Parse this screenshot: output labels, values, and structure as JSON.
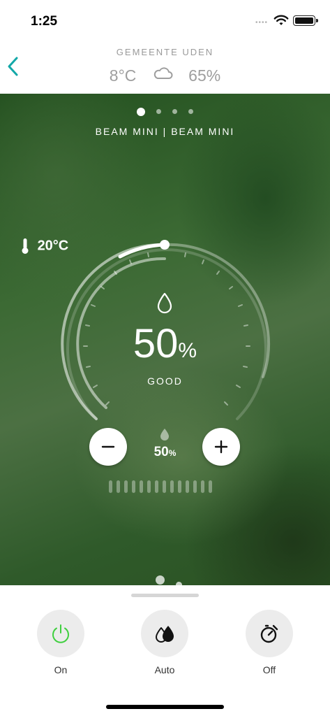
{
  "status_bar": {
    "time": "1:25",
    "signal_dots": "••••"
  },
  "header": {
    "location": "GEMEENTE UDEN",
    "outdoor_temp": "8°C",
    "weather_icon": "cloud-icon",
    "outdoor_humidity": "65%"
  },
  "carousel": {
    "pages": 4,
    "active_page": 1
  },
  "device": {
    "name": "BEAM MINI | BEAM MINI",
    "room_temperature": "20°C",
    "humidity_value": "50",
    "humidity_unit": "%",
    "humidity_status": "GOOD",
    "target_value": "50",
    "target_unit": "%",
    "dial_level_fraction": 0.5,
    "fan_levels": 14
  },
  "actions": [
    {
      "label": "On",
      "icon": "power-icon",
      "color": "#3fcf3f"
    },
    {
      "label": "Auto",
      "icon": "drops-icon",
      "color": "#111111"
    },
    {
      "label": "Off",
      "icon": "timer-icon",
      "color": "#111111"
    }
  ],
  "colors": {
    "accent": "#13a8a8",
    "on_green": "#3fcf3f",
    "hero_green": "#3c6a34"
  }
}
